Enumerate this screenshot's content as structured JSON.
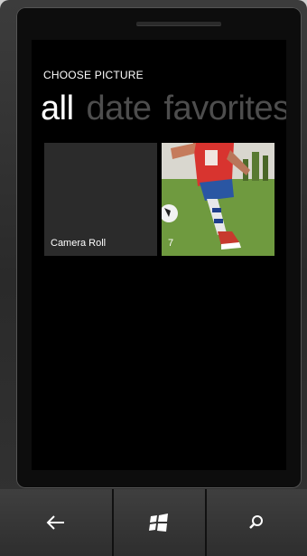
{
  "screen": {
    "subtitle": "CHOOSE PICTURE",
    "pivot_items": [
      {
        "label": "all",
        "active": true
      },
      {
        "label": "date",
        "active": false
      },
      {
        "label": "favorites",
        "active": false
      }
    ]
  },
  "tiles": [
    {
      "label": "Camera Roll"
    },
    {
      "label": "7"
    }
  ],
  "hardware_buttons": {
    "back_icon": "back-arrow-icon",
    "start_icon": "windows-logo-icon",
    "search_icon": "search-icon"
  }
}
